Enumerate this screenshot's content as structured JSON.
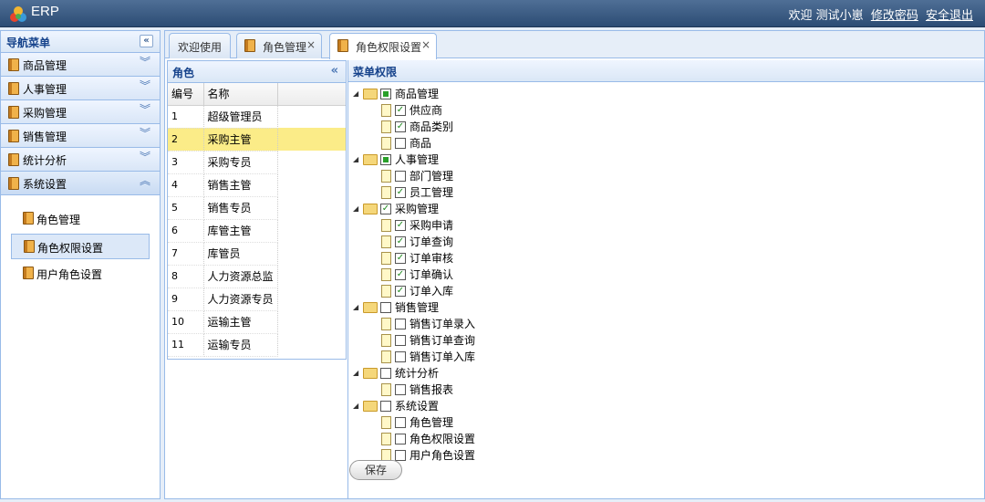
{
  "app": {
    "title": "ERP"
  },
  "user": {
    "welcome": "欢迎 测试小崽",
    "change_password": "修改密码",
    "logout": "安全退出"
  },
  "nav": {
    "title": "导航菜单",
    "collapse_glyph": "«",
    "groups": [
      {
        "label": "商品管理",
        "icon": "book-icon",
        "state": "collapsed"
      },
      {
        "label": "人事管理",
        "icon": "book-icon",
        "state": "collapsed"
      },
      {
        "label": "采购管理",
        "icon": "book-icon",
        "state": "collapsed"
      },
      {
        "label": "销售管理",
        "icon": "book-icon",
        "state": "collapsed"
      },
      {
        "label": "统计分析",
        "icon": "book-icon",
        "state": "collapsed"
      },
      {
        "label": "系统设置",
        "icon": "book-icon",
        "state": "expanded"
      }
    ],
    "items": [
      {
        "label": "角色管理",
        "active": false
      },
      {
        "label": "角色权限设置",
        "active": true
      },
      {
        "label": "用户角色设置",
        "active": false
      }
    ]
  },
  "tabs": [
    {
      "label": "欢迎使用",
      "closable": false,
      "active": false
    },
    {
      "label": "角色管理",
      "closable": true,
      "active": false
    },
    {
      "label": "角色权限设置",
      "closable": true,
      "active": true
    }
  ],
  "roles": {
    "title": "角色",
    "columns": [
      "编号",
      "名称"
    ],
    "rows": [
      {
        "id": "1",
        "name": "超级管理员"
      },
      {
        "id": "2",
        "name": "采购主管",
        "selected": true
      },
      {
        "id": "3",
        "name": "采购专员"
      },
      {
        "id": "4",
        "name": "销售主管"
      },
      {
        "id": "5",
        "name": "销售专员"
      },
      {
        "id": "6",
        "name": "库管主管"
      },
      {
        "id": "7",
        "name": "库管员"
      },
      {
        "id": "8",
        "name": "人力资源总监"
      },
      {
        "id": "9",
        "name": "人力资源专员"
      },
      {
        "id": "10",
        "name": "运输主管"
      },
      {
        "id": "11",
        "name": "运输专员"
      }
    ]
  },
  "permissions": {
    "title": "菜单权限",
    "save_label": "保存",
    "tree": [
      {
        "label": "商品管理",
        "state": "partial",
        "children": [
          {
            "label": "供应商",
            "checked": true
          },
          {
            "label": "商品类别",
            "checked": true
          },
          {
            "label": "商品",
            "checked": false
          }
        ]
      },
      {
        "label": "人事管理",
        "state": "partial",
        "children": [
          {
            "label": "部门管理",
            "checked": false
          },
          {
            "label": "员工管理",
            "checked": true
          }
        ]
      },
      {
        "label": "采购管理",
        "state": "checked",
        "children": [
          {
            "label": "采购申请",
            "checked": true
          },
          {
            "label": "订单查询",
            "checked": true
          },
          {
            "label": "订单审核",
            "checked": true
          },
          {
            "label": "订单确认",
            "checked": true
          },
          {
            "label": "订单入库",
            "checked": true
          }
        ]
      },
      {
        "label": "销售管理",
        "state": "unchecked",
        "children": [
          {
            "label": "销售订单录入",
            "checked": false
          },
          {
            "label": "销售订单查询",
            "checked": false
          },
          {
            "label": "销售订单入库",
            "checked": false
          }
        ]
      },
      {
        "label": "统计分析",
        "state": "unchecked",
        "children": [
          {
            "label": "销售报表",
            "checked": false
          }
        ]
      },
      {
        "label": "系统设置",
        "state": "unchecked",
        "children": [
          {
            "label": "角色管理",
            "checked": false
          },
          {
            "label": "角色权限设置",
            "checked": false
          },
          {
            "label": "用户角色设置",
            "checked": false
          }
        ]
      }
    ]
  }
}
